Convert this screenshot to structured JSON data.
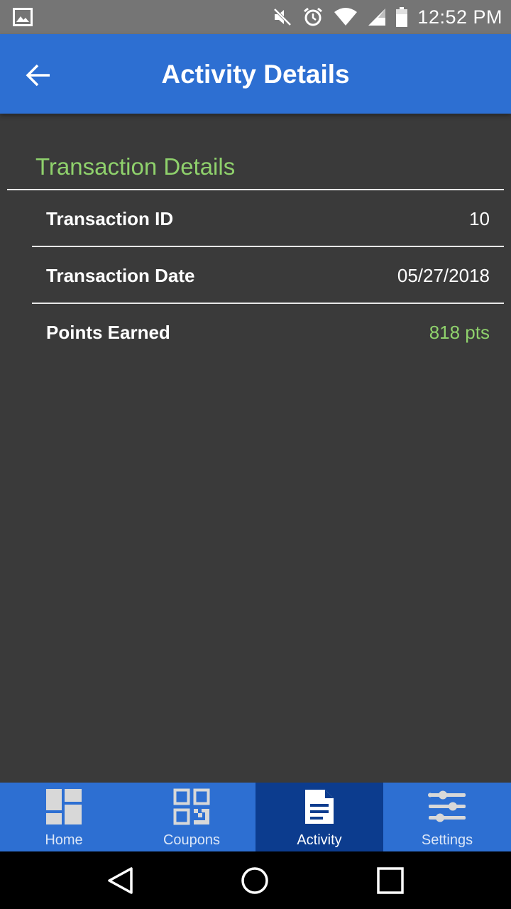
{
  "status_bar": {
    "time": "12:52 PM",
    "icons": [
      "image-icon",
      "mute-icon",
      "alarm-icon",
      "wifi-icon",
      "signal-icon",
      "battery-icon"
    ]
  },
  "app_bar": {
    "title": "Activity Details",
    "back_icon": "arrow-back-icon"
  },
  "section": {
    "title": "Transaction Details"
  },
  "details": [
    {
      "label": "Transaction ID",
      "value": "10"
    },
    {
      "label": "Transaction Date",
      "value": "05/27/2018"
    },
    {
      "label": "Points Earned",
      "value": "818 pts"
    }
  ],
  "bottom_nav": {
    "active": "Activity",
    "tabs": [
      {
        "label": "Home",
        "icon": "dashboard-icon"
      },
      {
        "label": "Coupons",
        "icon": "qr-code-icon"
      },
      {
        "label": "Activity",
        "icon": "document-icon"
      },
      {
        "label": "Settings",
        "icon": "sliders-icon"
      }
    ]
  },
  "system_nav": {
    "icons": [
      "back-triangle-icon",
      "home-circle-icon",
      "recents-square-icon"
    ]
  },
  "colors": {
    "primary": "#2d6fd2",
    "primary_dark": "#0c3c8e",
    "accent_green": "#8fd16c",
    "background": "#3a3a3a",
    "status_bar": "#757575"
  }
}
